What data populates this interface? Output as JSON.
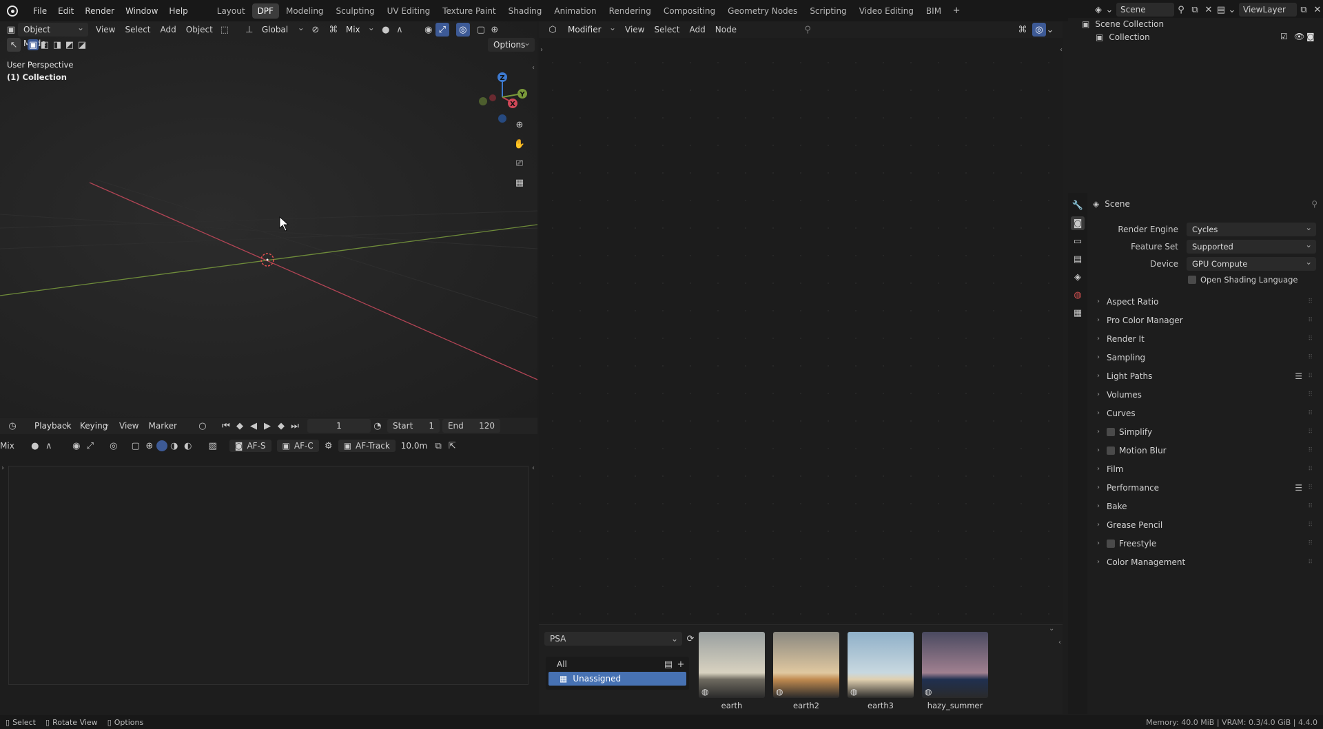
{
  "topbar": {
    "menu": [
      "File",
      "Edit",
      "Render",
      "Window",
      "Help"
    ],
    "workspaces": [
      {
        "label": "Layout",
        "active": false
      },
      {
        "label": "DPF",
        "active": true
      },
      {
        "label": "Modeling",
        "active": false
      },
      {
        "label": "Sculpting",
        "active": false
      },
      {
        "label": "UV Editing",
        "active": false
      },
      {
        "label": "Texture Paint",
        "active": false
      },
      {
        "label": "Shading",
        "active": false
      },
      {
        "label": "Animation",
        "active": false
      },
      {
        "label": "Rendering",
        "active": false
      },
      {
        "label": "Compositing",
        "active": false
      },
      {
        "label": "Geometry Nodes",
        "active": false
      },
      {
        "label": "Scripting",
        "active": false
      },
      {
        "label": "Video Editing",
        "active": false
      },
      {
        "label": "BIM",
        "active": false
      }
    ],
    "add_tab": "+",
    "scene": "Scene",
    "view_layer": "ViewLayer"
  },
  "viewport": {
    "mode": "Object Mode",
    "menus": [
      "View",
      "Select",
      "Add",
      "Object"
    ],
    "transform_orientation": "Global",
    "snap_mode": "Mix",
    "options_label": "Options",
    "overlay_title": "User Perspective",
    "overlay_collection": "(1) Collection",
    "gizmo": {
      "z": "Z",
      "y": "Y",
      "x": "X"
    }
  },
  "timeline": {
    "playback": "Playback",
    "keying": "Keying",
    "view": "View",
    "marker": "Marker",
    "current_frame": "1",
    "start_label": "Start",
    "start": "1",
    "end_label": "End",
    "end": "120"
  },
  "camera_bar": {
    "mix": "Mix",
    "af_s": "AF-S",
    "af_c": "AF-C",
    "af_track": "AF-Track",
    "distance": "10.0m"
  },
  "node_editor": {
    "type": "Modifier",
    "menus": [
      "View",
      "Select",
      "Add",
      "Node"
    ]
  },
  "asset_browser": {
    "library": "PSA",
    "catalogs": [
      {
        "label": "All",
        "selected": false
      },
      {
        "label": "Unassigned",
        "selected": true
      }
    ],
    "assets": [
      {
        "name": "earth",
        "sky_top": "#9aa0a0",
        "sky_mid": "#d8d2c0",
        "horizon": "#6e6a60"
      },
      {
        "name": "earth2",
        "sky_top": "#8a8880",
        "sky_mid": "#e0c8a0",
        "horizon": "#c08a50"
      },
      {
        "name": "earth3",
        "sky_top": "#8fb0c8",
        "sky_mid": "#c8d8e0",
        "horizon": "#e0d0b0"
      },
      {
        "name": "hazy_summer",
        "sky_top": "#4a4a60",
        "sky_mid": "#a08090",
        "horizon": "#203050"
      }
    ]
  },
  "outliner": {
    "scene_collection": "Scene Collection",
    "collection": "Collection"
  },
  "properties": {
    "context": "Scene",
    "fields": [
      {
        "label": "Render Engine",
        "value": "Cycles"
      },
      {
        "label": "Feature Set",
        "value": "Supported"
      },
      {
        "label": "Device",
        "value": "GPU Compute"
      }
    ],
    "osl_label": "Open Shading Language",
    "panels": [
      {
        "label": "Aspect Ratio",
        "checkbox": false,
        "list": false
      },
      {
        "label": "Pro Color Manager",
        "checkbox": false,
        "list": false
      },
      {
        "label": "Render It",
        "checkbox": false,
        "list": false
      },
      {
        "label": "Sampling",
        "checkbox": false,
        "list": false
      },
      {
        "label": "Light Paths",
        "checkbox": false,
        "list": true
      },
      {
        "label": "Volumes",
        "checkbox": false,
        "list": false
      },
      {
        "label": "Curves",
        "checkbox": false,
        "list": false
      },
      {
        "label": "Simplify",
        "checkbox": true,
        "list": false
      },
      {
        "label": "Motion Blur",
        "checkbox": true,
        "list": false
      },
      {
        "label": "Film",
        "checkbox": false,
        "list": false
      },
      {
        "label": "Performance",
        "checkbox": false,
        "list": true
      },
      {
        "label": "Bake",
        "checkbox": false,
        "list": false
      },
      {
        "label": "Grease Pencil",
        "checkbox": false,
        "list": false
      },
      {
        "label": "Freestyle",
        "checkbox": true,
        "list": false
      },
      {
        "label": "Color Management",
        "checkbox": false,
        "list": false
      }
    ]
  },
  "statusbar": {
    "select": "Select",
    "rotate": "Rotate View",
    "options": "Options",
    "memory": "Memory: 40.0 MiB | VRAM: 0.3/4.0 GiB | 4.4.0"
  },
  "colors": {
    "accent": "#4772b3",
    "x_axis": "#c04050",
    "y_axis": "#7a9a3a",
    "z_axis": "#3d7ad0"
  }
}
